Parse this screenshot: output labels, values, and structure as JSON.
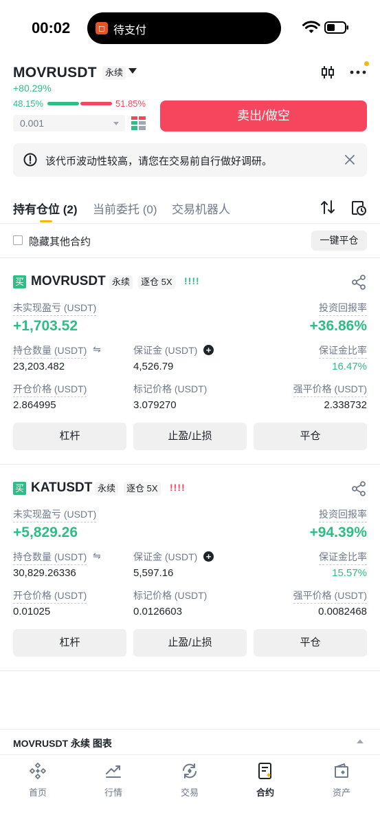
{
  "status_bar": {
    "time": "00:02",
    "island_text": "待支付",
    "island_icon": "wallet-icon"
  },
  "header": {
    "symbol": "MOVRUSDT",
    "contract_type": "永续",
    "change": "+80.29%",
    "buy_ratio": "48.15%",
    "sell_ratio": "51.85%",
    "buy_ratio_fraction": 0.4815
  },
  "order": {
    "quantity": "0.001",
    "sell_button": "卖出/做空"
  },
  "warning": {
    "text": "该代币波动性较高，请您在交易前自行做好调研。"
  },
  "tabs": [
    {
      "label": "持有仓位 (2)",
      "active": true
    },
    {
      "label": "当前委托 (0)",
      "active": false
    },
    {
      "label": "交易机器人",
      "active": false
    }
  ],
  "filter": {
    "hide_label": "隐藏其他合约",
    "close_all": "一键平仓"
  },
  "positions": [
    {
      "side_badge": "买",
      "symbol": "MOVRUSDT",
      "tag": "永续",
      "margin_mode": "逐仓 5X",
      "bars": "!!!!",
      "bars_color": "#2ebd85",
      "pnl_label": "未实现盈亏 (USDT)",
      "pnl": "+1,703.52",
      "roe_label": "投资回报率",
      "roe": "+36.86%",
      "size_label": "持仓数量 (USDT)",
      "size": "23,203.482",
      "margin_label": "保证金 (USDT)",
      "margin": "4,526.79",
      "margin_ratio_label": "保证金比率",
      "margin_ratio": "16.47%",
      "entry_label": "开仓价格 (USDT)",
      "entry": "2.864995",
      "mark_label": "标记价格 (USDT)",
      "mark": "3.079270",
      "liq_label": "强平价格 (USDT)",
      "liq": "2.338732",
      "buttons": [
        "杠杆",
        "止盈/止损",
        "平仓"
      ]
    },
    {
      "side_badge": "买",
      "symbol": "KATUSDT",
      "tag": "永续",
      "margin_mode": "逐仓 5X",
      "bars": "!!!!",
      "bars_color": "#f6465d",
      "pnl_label": "未实现盈亏 (USDT)",
      "pnl": "+5,829.26",
      "roe_label": "投资回报率",
      "roe": "+94.39%",
      "size_label": "持仓数量 (USDT)",
      "size": "30,829.26336",
      "margin_label": "保证金 (USDT)",
      "margin": "5,597.16",
      "margin_ratio_label": "保证金比率",
      "margin_ratio": "15.57%",
      "entry_label": "开仓价格 (USDT)",
      "entry": "0.01025",
      "mark_label": "标记价格 (USDT)",
      "mark": "0.0126603",
      "liq_label": "强平价格 (USDT)",
      "liq": "0.0082468",
      "buttons": [
        "杠杆",
        "止盈/止损",
        "平仓"
      ]
    }
  ],
  "chart_bar": {
    "text": "MOVRUSDT 永续 图表"
  },
  "nav": [
    {
      "label": "首页",
      "icon": "home-icon",
      "active": false
    },
    {
      "label": "行情",
      "icon": "markets-icon",
      "active": false
    },
    {
      "label": "交易",
      "icon": "trade-icon",
      "active": false
    },
    {
      "label": "合约",
      "icon": "futures-icon",
      "active": true
    },
    {
      "label": "资产",
      "icon": "wallet-icon",
      "active": false
    }
  ],
  "colors": {
    "green": "#2ebd85",
    "red": "#f6465d",
    "accent": "#f0b90b"
  }
}
